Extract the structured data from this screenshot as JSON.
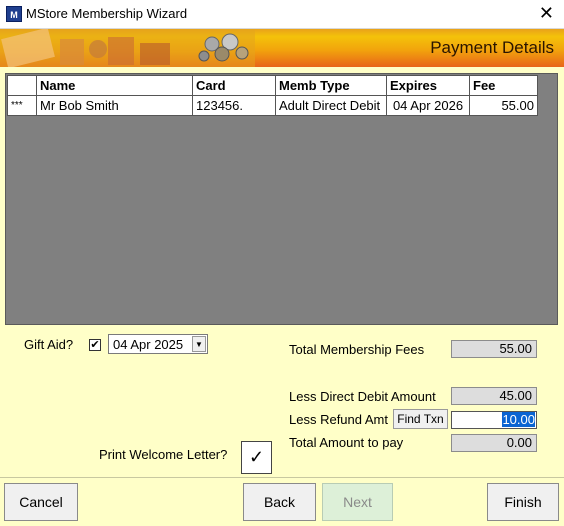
{
  "window": {
    "title": "MStore Membership Wizard",
    "icon_text": "M",
    "close_glyph": "✕"
  },
  "banner": {
    "title": "Payment Details"
  },
  "grid": {
    "headers": [
      "",
      "Name",
      "Card",
      "Memb Type",
      "Expires",
      "Fee"
    ],
    "rows": [
      {
        "marker": "***",
        "name": "Mr Bob Smith",
        "card": "123456.",
        "memb_type": "Adult Direct Debit",
        "expires": "04 Apr 2026",
        "fee": "55.00"
      }
    ]
  },
  "gift_aid": {
    "label": "Gift Aid?",
    "checked": true,
    "check_glyph": "✔",
    "date": "04  Apr  2025",
    "dropdown_glyph": "▼"
  },
  "totals": {
    "total_fees_label": "Total Membership Fees",
    "total_fees_value": "55.00",
    "less_dd_label": "Less Direct Debit Amount",
    "less_dd_value": "45.00",
    "less_refund_label": "Less Refund Amt",
    "find_txn_label": "Find Txn",
    "less_refund_value": "10.00",
    "total_pay_label": "Total Amount to pay",
    "total_pay_value": "0.00"
  },
  "welcome": {
    "label": "Print Welcome Letter?",
    "check_glyph": "✓"
  },
  "buttons": {
    "cancel": "Cancel",
    "back": "Back",
    "next": "Next",
    "finish": "Finish"
  },
  "colors": {
    "background": "#ffffc8",
    "banner_start": "#f4c20a",
    "banner_end": "#e8641a",
    "grid_bg": "#808080",
    "selection": "#0a64d2",
    "next_disabled": "#ddf0d8"
  }
}
